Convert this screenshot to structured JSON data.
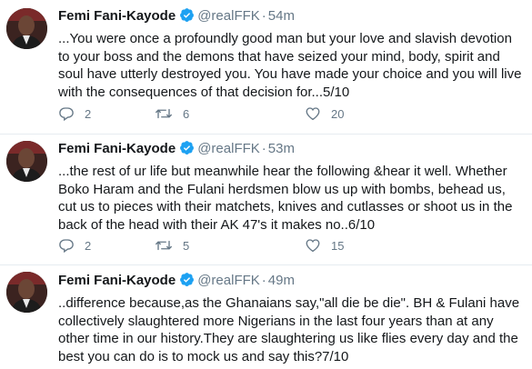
{
  "tweets": [
    {
      "name": "Femi Fani-Kayode",
      "handle": "@realFFK",
      "separator": "·",
      "time": "54m",
      "text": "...You were once a profoundly good man but your love and slavish devotion to your boss and the demons that have seized your mind, body, spirit and soul have utterly destroyed you. You have made your choice and you will live with the consequences of that decision for...5/10",
      "replies": "2",
      "retweets": "6",
      "likes": "20"
    },
    {
      "name": "Femi Fani-Kayode",
      "handle": "@realFFK",
      "separator": "·",
      "time": "53m",
      "text": "...the rest of ur life but meanwhile hear the following &hear it well. Whether Boko Haram and the Fulani herdsmen blow us up with bombs, behead us, cut us to pieces with their matchets, knives and cutlasses or shoot us in the back of the head with their AK 47's it makes no..6/10",
      "replies": "2",
      "retweets": "5",
      "likes": "15"
    },
    {
      "name": "Femi Fani-Kayode",
      "handle": "@realFFK",
      "separator": "·",
      "time": "49m",
      "text": "..difference because,as the Ghanaians say,\"all die be die\". BH & Fulani have collectively slaughtered more Nigerians in the last four years than at any other time in our history.They are slaughtering us like flies every day and the best you can do is to mock us and say this?7/10"
    }
  ],
  "colors": {
    "verified": "#1da1f2",
    "muted": "#657786",
    "text": "#14171a",
    "divider": "#e6ecf0"
  },
  "icons": {
    "verified": "verified-badge-icon",
    "reply": "reply-icon",
    "retweet": "retweet-icon",
    "like": "heart-icon"
  }
}
